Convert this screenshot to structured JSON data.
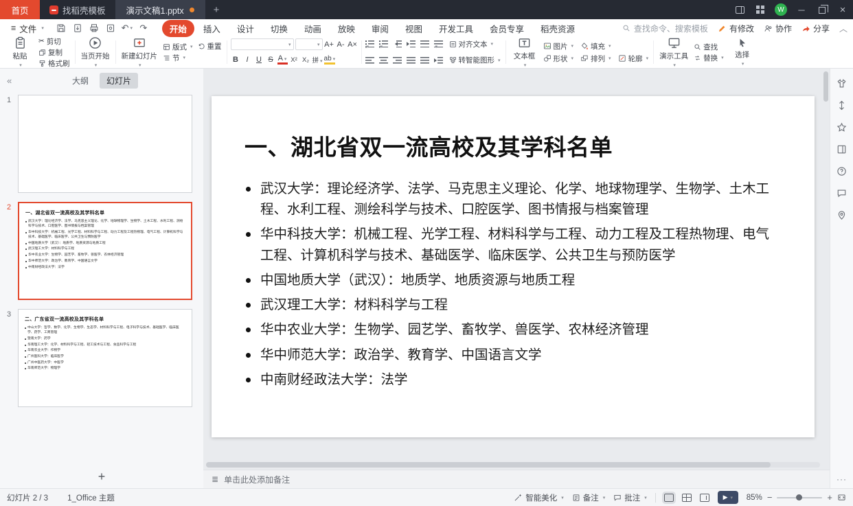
{
  "colors": {
    "accent": "#e3492e",
    "titlebar_bg": "#262a33",
    "doc_tab_bg": "#3a3f4b",
    "play_button": "#3d4a66",
    "avatar_green": "#2fb350",
    "modified_orange": "#f0882e"
  },
  "titlebar": {
    "home_tab": "首页",
    "template_tab": "找稻壳模板",
    "doc_tab": "演示文稿1.pptx"
  },
  "menubar": {
    "file": "文件",
    "tabs": [
      "开始",
      "插入",
      "设计",
      "切换",
      "动画",
      "放映",
      "审阅",
      "视图",
      "开发工具",
      "会员专享",
      "稻壳资源"
    ],
    "search": "查找命令、搜索模板",
    "modified": "有修改",
    "collaborate": "协作",
    "share": "分享"
  },
  "ribbon": {
    "paste": "粘贴",
    "cut": "剪切",
    "copy": "复制",
    "format_painter": "格式刷",
    "play_current": "当页开始",
    "new_slide": "新建幻灯片",
    "layout": "版式",
    "section": "节",
    "reset": "重置",
    "align_text": "对齐文本",
    "to_smartart": "转智能图形",
    "textbox": "文本框",
    "picture": "图片",
    "fill": "填充",
    "shape": "形状",
    "arrange": "排列",
    "outline": "轮廓",
    "present_tools": "演示工具",
    "find": "查找",
    "replace": "替换",
    "select": "选择"
  },
  "icons": {
    "file_menu": "≡",
    "cut": "✂",
    "undo": "↶",
    "redo": "↷",
    "bold": "B",
    "italic": "I",
    "underline": "U",
    "strike": "S",
    "font_color": "A",
    "sup": "X²",
    "sub": "X₂",
    "phonetic": "拼",
    "highlight": "ab",
    "inc_font": "A+",
    "dec_font": "A-",
    "clear_format": "A×",
    "minimize": "─",
    "close": "×",
    "new_tab": "+",
    "collapse_panel": "«",
    "add": "+",
    "more": "···",
    "notes_list": "≣",
    "play": "▶",
    "zoom_in": "+",
    "zoom_out": "−",
    "collapse_ribbon": "︿",
    "avatar_letter": "W"
  },
  "sidebar": {
    "outline_tab": "大纲",
    "slides_tab": "幻灯片",
    "slides": [
      {
        "num": "1",
        "title": "",
        "bullets": []
      },
      {
        "num": "2",
        "title": "一、湖北省双一流高校及其学科名单",
        "bullets": [
          "武汉大学：理论经济学、法学、马克思主义理论、化学、地球物理学、生物学、土木工程、水利工程、测绘科学与技术、口腔医学、图书情报与档案管理",
          "华中科技大学：机械工程、光学工程、材料科学与工程、动力工程及工程热物理、电气工程、计算机科学与技术、基础医学、临床医学、公共卫生与预防医学",
          "中国地质大学（武汉）：地质学、地质资源与地质工程",
          "武汉理工大学：材料科学与工程",
          "华中农业大学：生物学、园艺学、畜牧学、兽医学、农林经济管理",
          "华中师范大学：政治学、教育学、中国语言文学",
          "中南财经政法大学：法学"
        ]
      },
      {
        "num": "3",
        "title": "二、广东省双一流高校及其学科名单",
        "bullets": [
          "中山大学：哲学、数学、化学、生物学、生态学、材料科学与工程、电子科学与技术、基础医学、临床医学、药学、工商管理",
          "暨南大学：药学",
          "华南理工大学：化学、材料科学与工程、轻工技术与工程、食品科学与工程",
          "华南农业大学：作物学",
          "广州医科大学：临床医学",
          "广州中医药大学：中医学",
          "华南师范大学：物理学"
        ]
      }
    ]
  },
  "slide": {
    "title": "一、湖北省双一流高校及其学科名单",
    "bullets": [
      "武汉大学：理论经济学、法学、马克思主义理论、化学、地球物理学、生物学、土木工程、水利工程、测绘科学与技术、口腔医学、图书情报与档案管理",
      "华中科技大学：机械工程、光学工程、材料科学与工程、动力工程及工程热物理、电气工程、计算机科学与技术、基础医学、临床医学、公共卫生与预防医学",
      "中国地质大学（武汉）：地质学、地质资源与地质工程",
      "武汉理工大学：材料科学与工程",
      "华中农业大学：生物学、园艺学、畜牧学、兽医学、农林经济管理",
      "华中师范大学：政治学、教育学、中国语言文学",
      "中南财经政法大学：法学"
    ]
  },
  "notes": {
    "placeholder": "单击此处添加备注"
  },
  "statusbar": {
    "slide_counter": "幻灯片 2 / 3",
    "theme": "1_Office 主题",
    "smart_beautify": "智能美化",
    "notes_btn": "备注",
    "comments_btn": "批注",
    "zoom": "85%"
  }
}
